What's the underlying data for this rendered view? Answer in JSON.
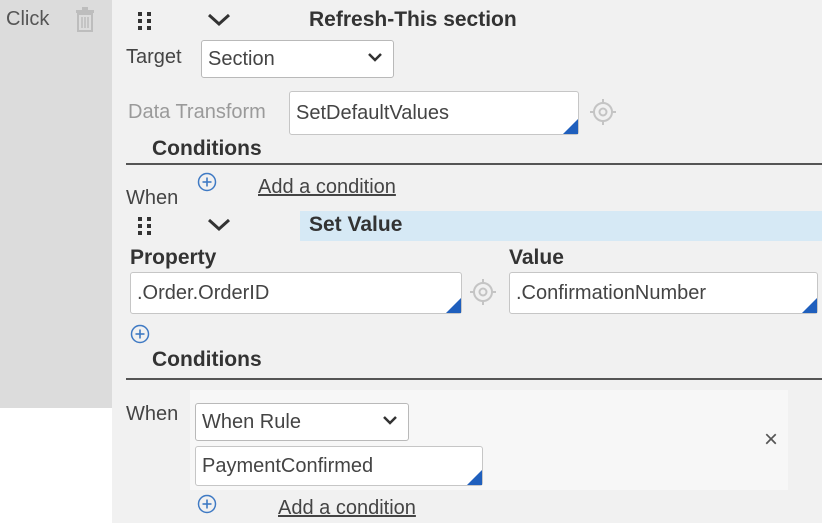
{
  "sidebar": {
    "click_label": "Click"
  },
  "refresh_action": {
    "title": "Refresh-This section",
    "target_label": "Target",
    "target_value": "Section",
    "data_transform_label": "Data Transform",
    "data_transform_value": "SetDefaultValues",
    "conditions_heading": "Conditions",
    "when_label": "When",
    "add_condition_link": "Add a condition"
  },
  "set_value_action": {
    "title": "Set Value",
    "property_label": "Property",
    "value_label": "Value",
    "property_value": ".Order.OrderID",
    "value_value": ".ConfirmationNumber",
    "conditions_heading": "Conditions",
    "when_label": "When",
    "when_rule_value": "When Rule",
    "rule_name_value": "PaymentConfirmed",
    "add_condition_link": "Add a condition",
    "close_glyph": "×"
  },
  "colors": {
    "accent": "#1f5fbd",
    "highlight": "#d6e9f5",
    "strip": "#dcdcdc"
  },
  "icons": [
    "trash-icon",
    "drag-handle-icon",
    "chevron-down-icon",
    "target-icon",
    "plus-circle-icon",
    "close-icon"
  ]
}
